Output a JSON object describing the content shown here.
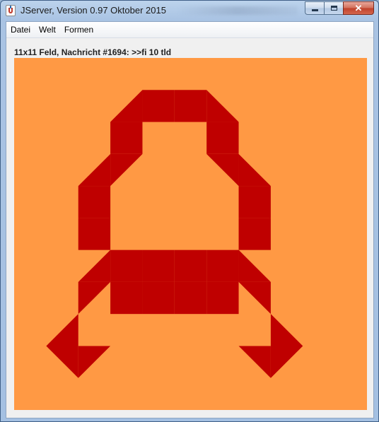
{
  "window": {
    "title": "JServer, Version 0.97 Oktober 2015",
    "icon": "java-cup-icon",
    "caption_buttons": {
      "minimize": "minimize-icon",
      "maximize": "maximize-icon",
      "close": "✕"
    }
  },
  "menubar": {
    "items": [
      {
        "label": "Datei"
      },
      {
        "label": "Welt"
      },
      {
        "label": "Formen"
      }
    ]
  },
  "status": {
    "text": "11x11 Feld, Nachricht #1694: >>fi 10 tld"
  },
  "board": {
    "rows": 11,
    "cols": 11,
    "background_color": "#ff9944",
    "shape_color": "#bf0000",
    "shapes": [
      {
        "type": "full",
        "row": 2,
        "col": 3
      },
      {
        "type": "full",
        "row": 2,
        "col": 6
      },
      {
        "type": "full",
        "row": 4,
        "col": 2
      },
      {
        "type": "full",
        "row": 4,
        "col": 7
      },
      {
        "type": "full",
        "row": 5,
        "col": 2
      },
      {
        "type": "full",
        "row": 5,
        "col": 7
      },
      {
        "type": "full",
        "row": 6,
        "col": 3
      },
      {
        "type": "full",
        "row": 6,
        "col": 4
      },
      {
        "type": "full",
        "row": 6,
        "col": 5
      },
      {
        "type": "full",
        "row": 6,
        "col": 6
      },
      {
        "type": "tri",
        "row": 1,
        "col": 3,
        "corner": "br"
      },
      {
        "type": "full",
        "row": 1,
        "col": 4,
        "part": "top"
      },
      {
        "type": "full",
        "row": 1,
        "col": 5,
        "part": "top"
      },
      {
        "type": "tri",
        "row": 1,
        "col": 6,
        "corner": "bl"
      },
      {
        "type": "tri",
        "row": 3,
        "col": 3,
        "corner": "tl"
      },
      {
        "type": "tri",
        "row": 3,
        "col": 6,
        "corner": "tr"
      },
      {
        "type": "tri",
        "row": 3,
        "col": 2,
        "corner": "br"
      },
      {
        "type": "tri",
        "row": 3,
        "col": 7,
        "corner": "bl"
      },
      {
        "type": "tri",
        "row": 6,
        "col": 2,
        "corner": "br"
      },
      {
        "type": "tri",
        "row": 6,
        "col": 7,
        "corner": "bl"
      },
      {
        "type": "tri",
        "row": 7,
        "col": 2,
        "corner": "tl"
      },
      {
        "type": "tri",
        "row": 7,
        "col": 7,
        "corner": "tr"
      },
      {
        "type": "tri",
        "row": 8,
        "col": 1,
        "corner": "br"
      },
      {
        "type": "tri",
        "row": 8,
        "col": 8,
        "corner": "bl"
      },
      {
        "type": "tri",
        "row": 9,
        "col": 1,
        "corner": "tr"
      },
      {
        "type": "tri",
        "row": 9,
        "col": 2,
        "corner": "tl"
      },
      {
        "type": "tri",
        "row": 9,
        "col": 7,
        "corner": "tr"
      },
      {
        "type": "tri",
        "row": 9,
        "col": 8,
        "corner": "tl"
      },
      {
        "type": "full",
        "row": 7,
        "col": 3,
        "part": "top"
      },
      {
        "type": "full",
        "row": 7,
        "col": 4,
        "part": "top"
      },
      {
        "type": "full",
        "row": 7,
        "col": 5,
        "part": "top"
      },
      {
        "type": "full",
        "row": 7,
        "col": 6,
        "part": "top"
      }
    ]
  }
}
